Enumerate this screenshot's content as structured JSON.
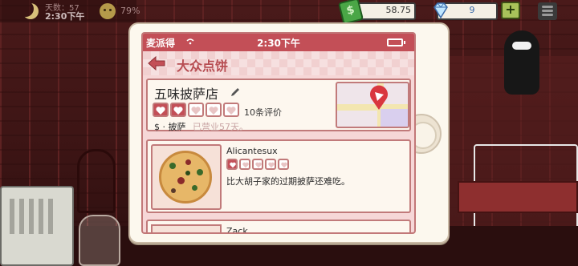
{
  "hud": {
    "day": "天数：57",
    "time": "2:30下午",
    "mood": "79%",
    "money": "58.75",
    "gems": "9",
    "plus": "+"
  },
  "phone": {
    "carrier": "麦派得",
    "clock": "2:30下午",
    "app_title": "大众点饼",
    "shop": {
      "name": "五味披萨店",
      "rating": 2,
      "max_rating": 5,
      "review_count": "10条评价",
      "tag": "$ · 披萨",
      "days_open": "已营业57天。"
    },
    "reviews": [
      {
        "reviewer": "Alicantesux",
        "rating": 1,
        "max_rating": 5,
        "text": "比大胡子家的过期披萨还难吃。"
      },
      {
        "reviewer": "Zack..."
      }
    ]
  },
  "colors": {
    "accent": "#c34f57",
    "card_border": "#c17a7a",
    "title": "#b74d52",
    "money_green": "#4aa646",
    "plus_green": "#a9c25a"
  }
}
